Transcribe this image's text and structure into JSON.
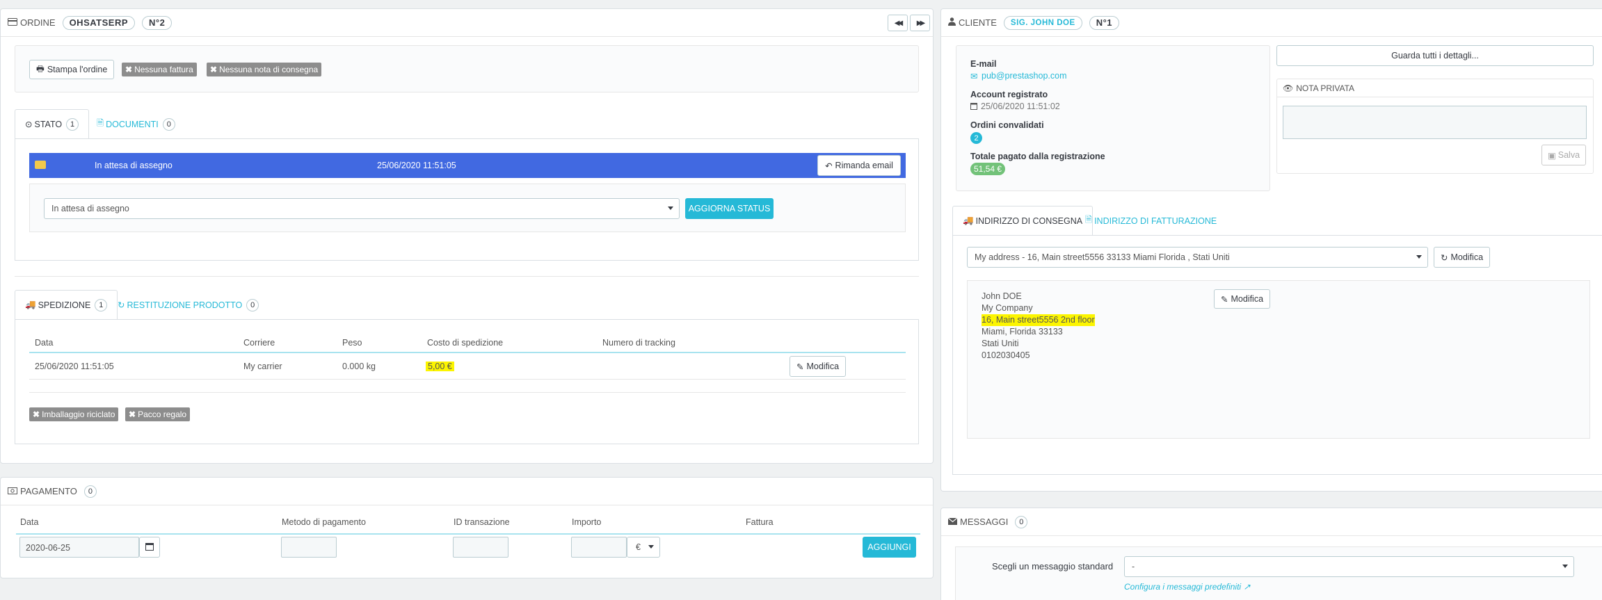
{
  "order": {
    "title": "ORDINE",
    "reference": "OHSATSERP",
    "number": "N°2",
    "print_label": "Stampa l'ordine",
    "no_invoice": "Nessuna fattura",
    "no_delivery": "Nessuna nota di consegna",
    "tab_status": "STATO",
    "tab_status_count": "1",
    "tab_documents": "DOCUMENTI",
    "tab_documents_count": "0",
    "status_current": "In attesa di assegno",
    "status_date": "25/06/2020 11:51:05",
    "resend_email": "Rimanda email",
    "status_select": "In attesa di assegno",
    "update_status": "AGGIORNA STATUS",
    "tab_shipping": "SPEDIZIONE",
    "tab_shipping_count": "1",
    "tab_return": "RESTITUZIONE PRODOTTO",
    "tab_return_count": "0",
    "ship_headers": [
      "Data",
      "Corriere",
      "Peso",
      "Costo di spedizione",
      "Numero di tracking"
    ],
    "ship_row": {
      "date": "25/06/2020 11:51:05",
      "carrier": "My carrier",
      "weight": "0.000 kg",
      "cost": "5,00 €"
    },
    "edit_label": "Modifica",
    "recycled": "Imballaggio riciclato",
    "gift": "Pacco regalo"
  },
  "payment": {
    "title": "PAGAMENTO",
    "count": "0",
    "headers": [
      "Data",
      "Metodo di pagamento",
      "ID transazione",
      "Importo",
      "Fattura"
    ],
    "date_value": "2020-06-25",
    "currency": "€",
    "add_label": "AGGIUNGI"
  },
  "customer": {
    "title": "CLIENTE",
    "name": "SIG. JOHN DOE",
    "number": "N°1",
    "email_label": "E-mail",
    "email": "pub@prestashop.com",
    "registered_label": "Account registrato",
    "registered": "25/06/2020 11:51:02",
    "valid_orders_label": "Ordini convalidati",
    "valid_orders": "2",
    "total_paid_label": "Totale pagato dalla registrazione",
    "total_paid": "51,54 €",
    "details_button": "Guarda tutti i dettagli...",
    "private_note": "NOTA PRIVATA",
    "save_label": "Salva",
    "tab_delivery": "INDIRIZZO DI CONSEGNA",
    "tab_invoice": "INDIRIZZO DI FATTURAZIONE",
    "address_select": "My address - 16, Main street5556 33133 Miami Florida , Stati Uniti",
    "edit_label": "Modifica",
    "address_lines": [
      "John DOE",
      "My Company",
      "16, Main street5556 2nd floor",
      "Miami, Florida 33133",
      "Stati Uniti",
      "0102030405"
    ]
  },
  "messages": {
    "title": "MESSAGGI",
    "count": "0",
    "choose_label": "Scegli un messaggio standard",
    "choose_value": "-",
    "configure_link": "Configura i messaggi predefiniti"
  },
  "colors": {
    "accent": "#25b9d7",
    "status_bar": "#4169e1",
    "highlight": "#fcf500",
    "success": "#72c279"
  }
}
